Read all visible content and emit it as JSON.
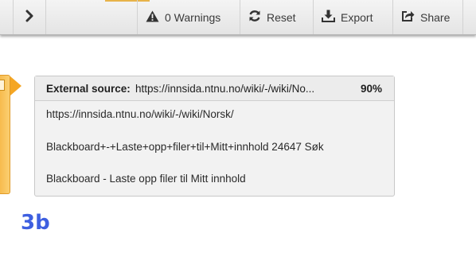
{
  "toolbar": {
    "warnings_label": "0 Warnings",
    "reset_label": "Reset",
    "export_label": "Export",
    "share_label": "Share"
  },
  "source_card": {
    "label": "External source:",
    "url_truncated": "https://innsida.ntnu.no/wiki/-/wiki/No...",
    "match_percent": "90%",
    "lines": [
      "https://innsida.ntnu.no/wiki/-/wiki/Norsk/",
      "Blackboard+-+Laste+opp+filer+til+Mitt+innhold 24647 Søk",
      "Blackboard - Laste opp filer til Mitt innhold"
    ]
  },
  "step_label": "3b",
  "colors": {
    "accent_orange": "#f5a623",
    "step_blue": "#3e5fe0"
  },
  "icons": [
    "chevron-right-icon",
    "warning-icon",
    "reset-icon",
    "export-icon",
    "share-icon"
  ]
}
